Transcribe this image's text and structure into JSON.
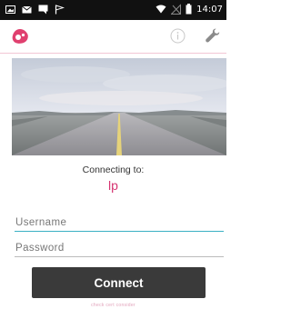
{
  "status_bar": {
    "time": "14:07",
    "left_icons": [
      "image-icon",
      "mail-icon",
      "chat-icon",
      "flag-icon"
    ],
    "right_icons": [
      "wifi-icon",
      "signal-icon",
      "battery-icon"
    ]
  },
  "app_bar": {
    "icons": [
      "app-logo-icon",
      "info-icon",
      "wrench-icon"
    ]
  },
  "hero": {
    "description_icon": "road-landscape-image"
  },
  "connection": {
    "label": "Connecting to:",
    "name": "lp"
  },
  "form": {
    "username_placeholder": "Username",
    "password_placeholder": "Password",
    "connect_label": "Connect"
  },
  "footer": {
    "text": "check cert consider"
  },
  "colors": {
    "accent": "#d63471",
    "focus_underline": "#3ab0c4",
    "button_bg": "#3a3a3a",
    "status_bar_bg": "#111111"
  }
}
